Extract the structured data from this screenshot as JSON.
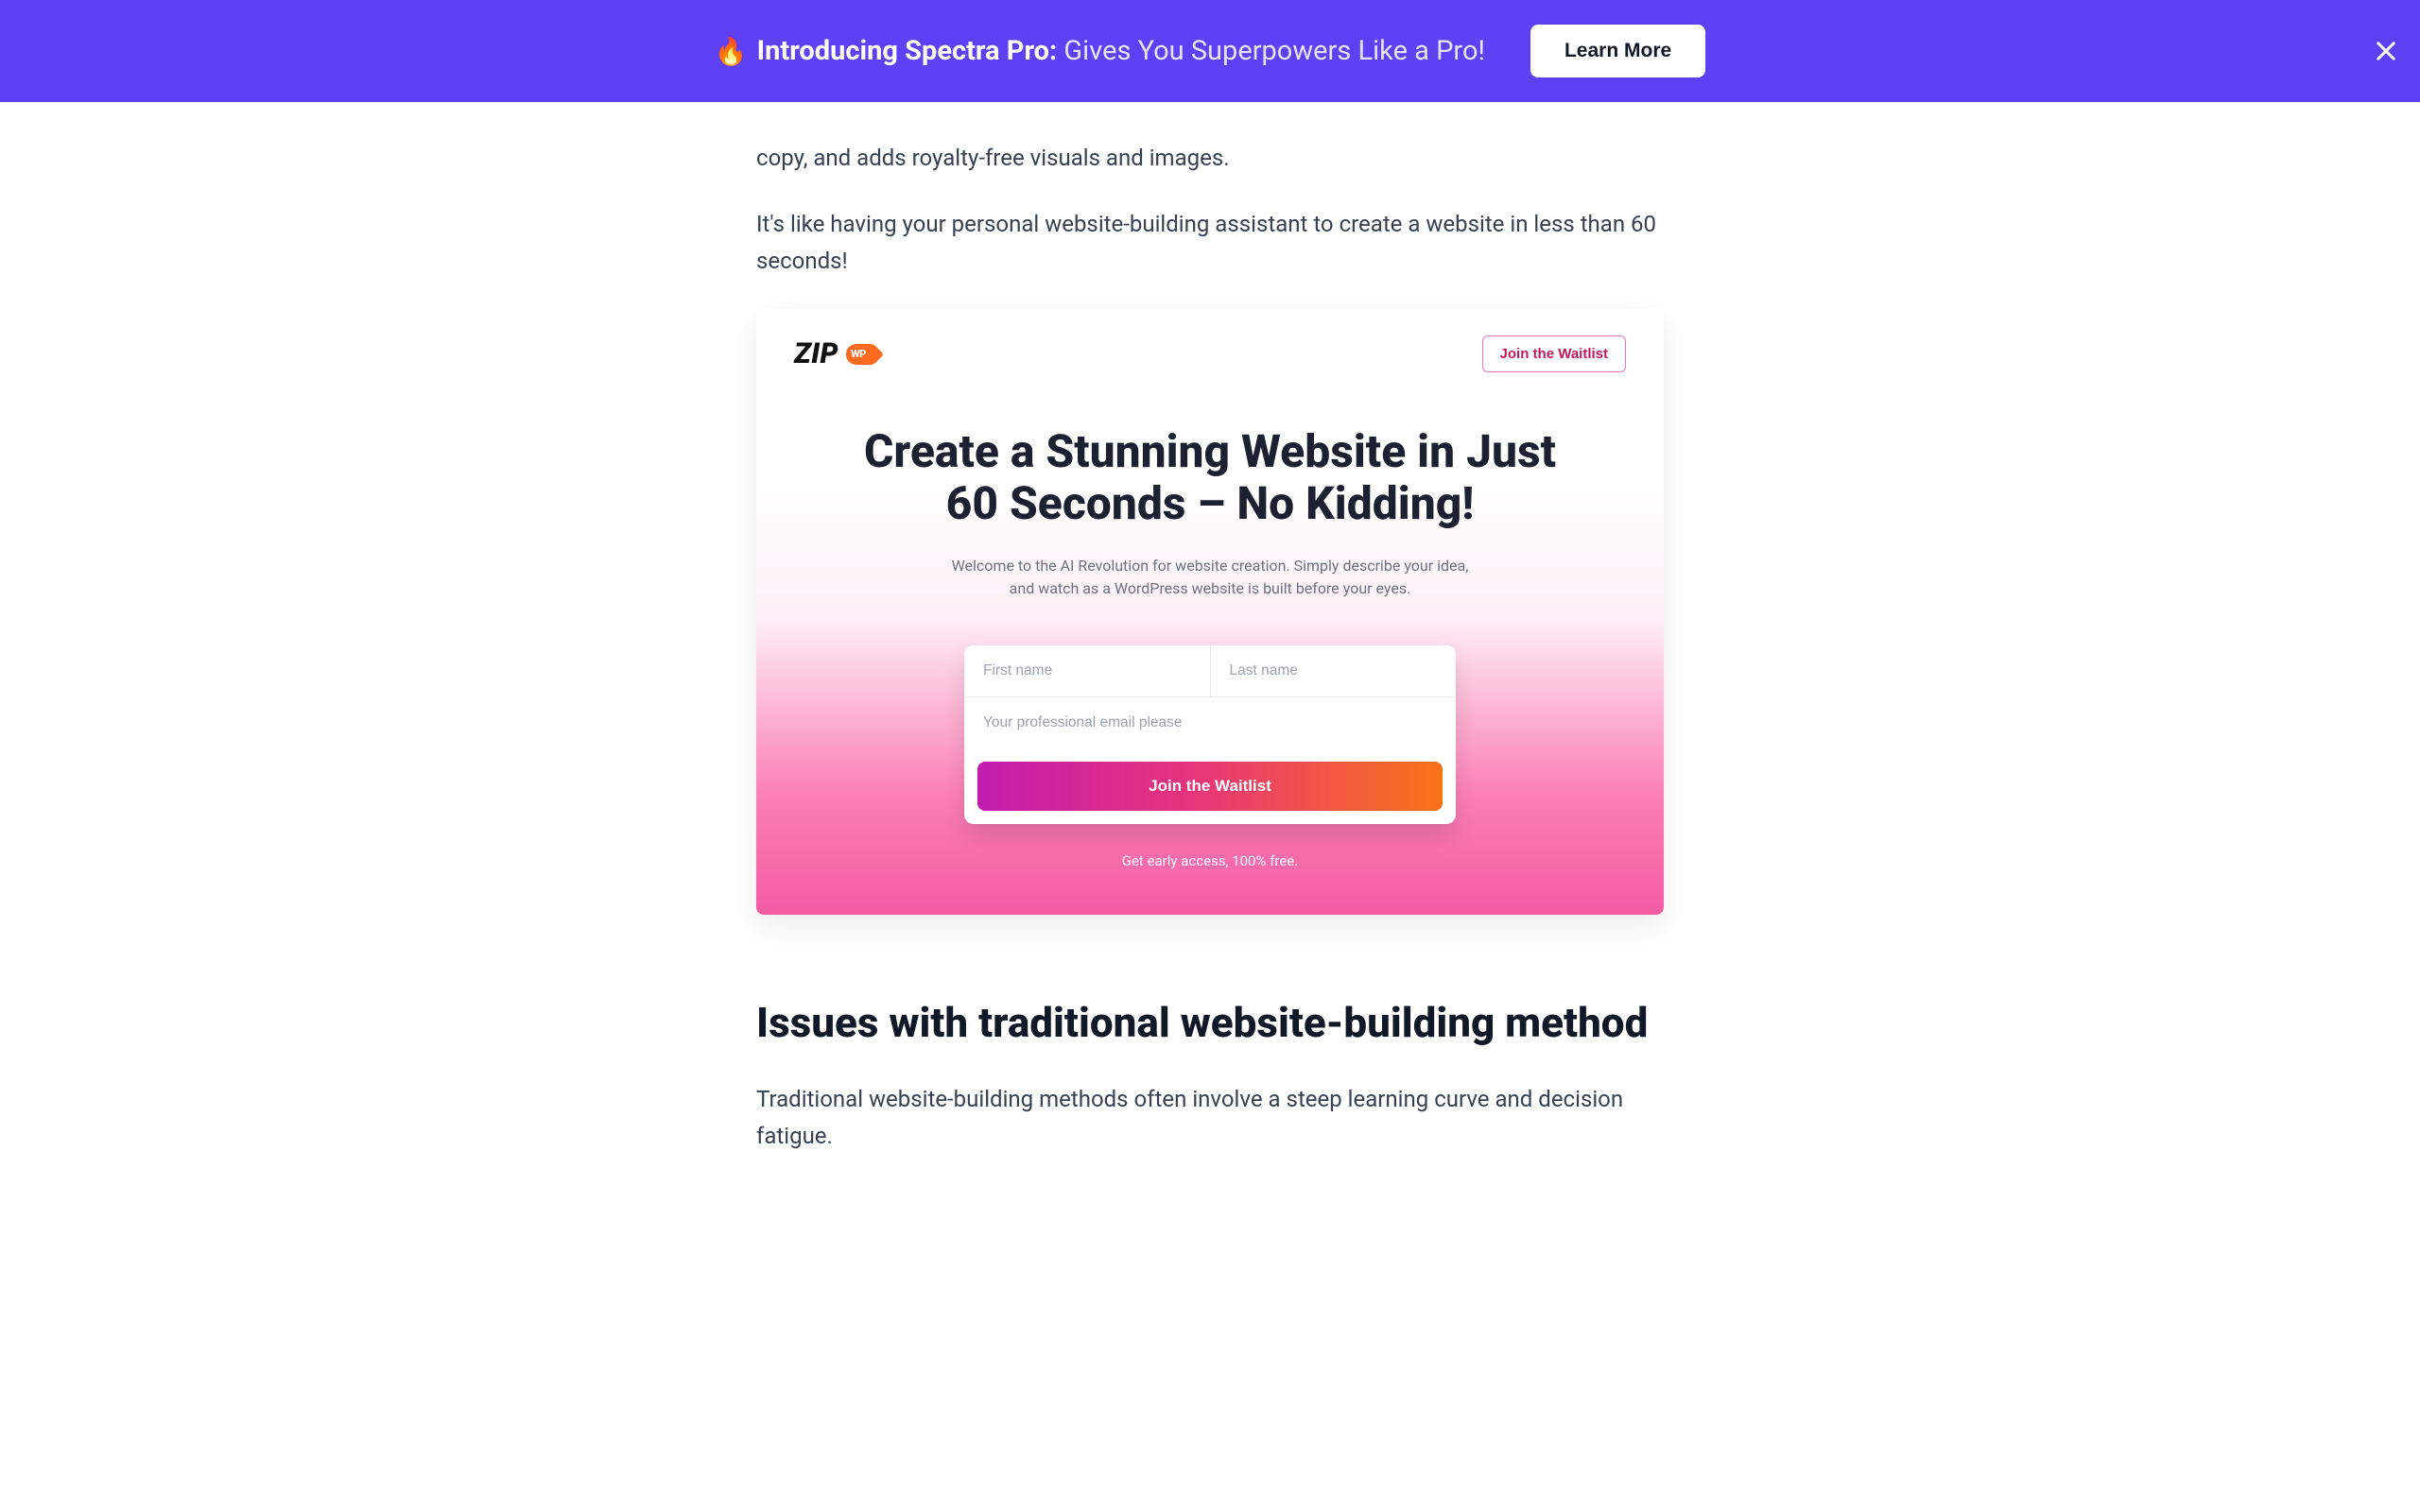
{
  "banner": {
    "emoji": "🔥",
    "lead": "Introducing Spectra Pro:",
    "tail": "Gives You Superpowers Like a Pro!",
    "cta": "Learn More"
  },
  "article": {
    "p1": "copy, and adds royalty-free visuals and images.",
    "p2": "It's like having your personal website-building assistant to create a website in less than 60 seconds!"
  },
  "zip": {
    "logo_text": "ZIP",
    "logo_badge": "WP",
    "join_btn": "Join the Waitlist",
    "headline": "Create a Stunning Website in Just 60 Seconds – No Kidding!",
    "subhead": "Welcome to the AI Revolution for website creation. Simply describe your idea, and watch as a WordPress website is built before your eyes.",
    "first_name_ph": "First name",
    "last_name_ph": "Last name",
    "email_ph": "Your professional email please",
    "submit": "Join the Waitlist",
    "early": "Get early access, 100% free."
  },
  "section": {
    "heading": "Issues with traditional website-building method",
    "p": "Traditional website-building methods often involve a steep learning curve and decision fatigue."
  }
}
